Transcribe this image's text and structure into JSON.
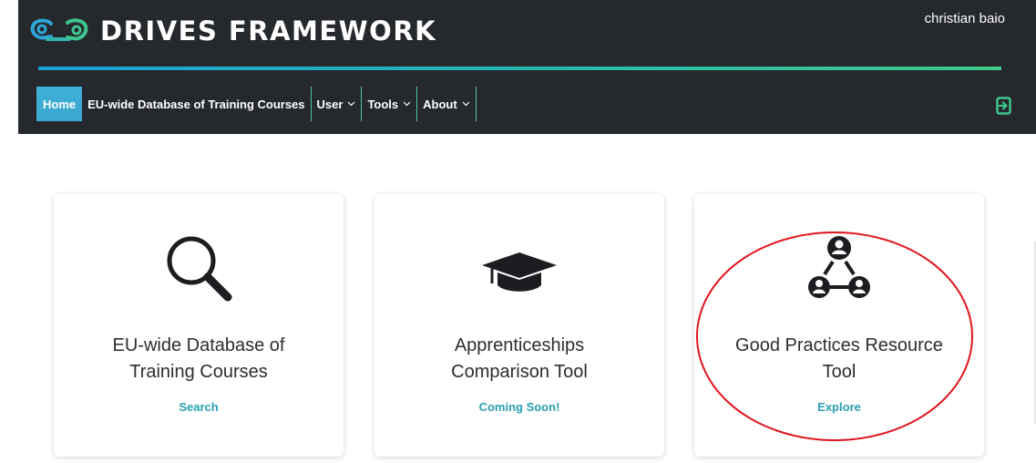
{
  "header": {
    "brand_name": "DRIVES FRAMEWORK",
    "user_name": "christian baio",
    "accent_gradient": [
      "#1aa2d8",
      "#41c98b"
    ]
  },
  "nav": {
    "items": [
      {
        "label": "Home",
        "active": true
      },
      {
        "label": "EU-wide Database of Training Courses"
      },
      {
        "label": "User",
        "dropdown": true
      },
      {
        "label": "Tools",
        "dropdown": true
      },
      {
        "label": "About",
        "dropdown": true
      }
    ],
    "logout_icon": "logout-icon"
  },
  "cards": [
    {
      "icon": "search-icon",
      "title_line1": "EU-wide Database of",
      "title_line2": "Training Courses",
      "action": "Search"
    },
    {
      "icon": "graduation-cap-icon",
      "title_line1": "Apprenticeships",
      "title_line2": "Comparison Tool",
      "action": "Coming Soon!"
    },
    {
      "icon": "network-users-icon",
      "title_line1": "Good Practices Resource",
      "title_line2": "Tool",
      "action": "Explore"
    }
  ],
  "colors": {
    "header_bg": "#25282c",
    "home_tab": "#3fb0d8",
    "action_link": "#2aa0b3",
    "annotation_ring": "#e0141c"
  }
}
